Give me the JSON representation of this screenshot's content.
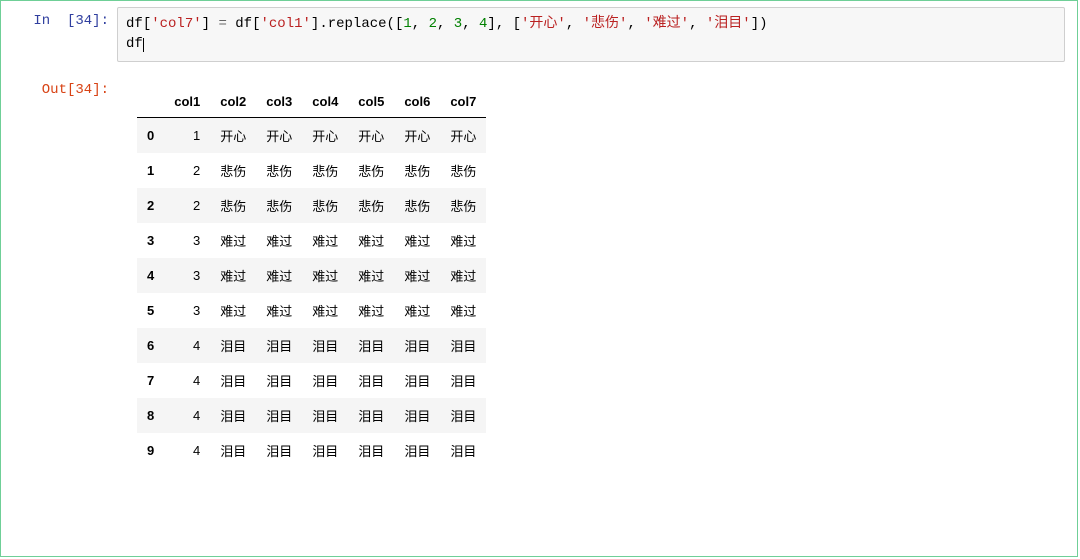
{
  "cell": {
    "in_prompt": "In  [34]:",
    "out_prompt": "Out[34]:",
    "code": {
      "t1": "df",
      "t2": "[",
      "t3": "'col7'",
      "t4": "]",
      "t5": " ",
      "t6": "=",
      "t7": " df",
      "t8": "[",
      "t9": "'col1'",
      "t10": "]",
      "t11": ".replace(",
      "t12": "[",
      "n1": "1",
      "c1": ", ",
      "n2": "2",
      "c2": ", ",
      "n3": "3",
      "c3": ", ",
      "n4": "4",
      "t13": "]",
      "c4": ", ",
      "t14": "[",
      "s1": "'开心'",
      "c5": ", ",
      "s2": "'悲伤'",
      "c6": ", ",
      "s3": "'难过'",
      "c7": ", ",
      "s4": "'泪目'",
      "t15": "]",
      "t16": ")",
      "line2": "df"
    }
  },
  "table": {
    "columns": [
      "col1",
      "col2",
      "col3",
      "col4",
      "col5",
      "col6",
      "col7"
    ],
    "index": [
      "0",
      "1",
      "2",
      "3",
      "4",
      "5",
      "6",
      "7",
      "8",
      "9"
    ],
    "rows": [
      [
        "1",
        "开心",
        "开心",
        "开心",
        "开心",
        "开心",
        "开心"
      ],
      [
        "2",
        "悲伤",
        "悲伤",
        "悲伤",
        "悲伤",
        "悲伤",
        "悲伤"
      ],
      [
        "2",
        "悲伤",
        "悲伤",
        "悲伤",
        "悲伤",
        "悲伤",
        "悲伤"
      ],
      [
        "3",
        "难过",
        "难过",
        "难过",
        "难过",
        "难过",
        "难过"
      ],
      [
        "3",
        "难过",
        "难过",
        "难过",
        "难过",
        "难过",
        "难过"
      ],
      [
        "3",
        "难过",
        "难过",
        "难过",
        "难过",
        "难过",
        "难过"
      ],
      [
        "4",
        "泪目",
        "泪目",
        "泪目",
        "泪目",
        "泪目",
        "泪目"
      ],
      [
        "4",
        "泪目",
        "泪目",
        "泪目",
        "泪目",
        "泪目",
        "泪目"
      ],
      [
        "4",
        "泪目",
        "泪目",
        "泪目",
        "泪目",
        "泪目",
        "泪目"
      ],
      [
        "4",
        "泪目",
        "泪目",
        "泪目",
        "泪目",
        "泪目",
        "泪目"
      ]
    ]
  }
}
